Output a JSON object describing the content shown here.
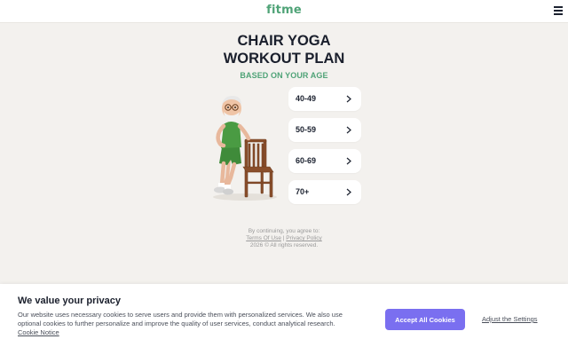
{
  "header": {
    "logo_text": "fitme",
    "brand_color": "#4fa377"
  },
  "hero": {
    "title_line1": "CHAIR YOGA",
    "title_line2": "WORKOUT PLAN",
    "subtitle": "BASED ON YOUR AGE"
  },
  "age_options": [
    {
      "label": "40-49"
    },
    {
      "label": "50-59"
    },
    {
      "label": "60-69"
    },
    {
      "label": "70+"
    }
  ],
  "legal": {
    "prefix": "By continuing, you agree to:",
    "terms_label": "Terms Of Use",
    "separator": "|",
    "privacy_label": "Privacy Policy",
    "copyright": "2026 © All rights reserved."
  },
  "cookie_banner": {
    "title": "We value your privacy",
    "text": "Our website uses necessary cookies to serve users and provide them with personalized services. We also use optional cookies to further personalize and improve the quality of user services, conduct analytical research.",
    "notice_link": "Cookie Notice",
    "accept_label": "Accept All Cookies",
    "adjust_label": "Adjust the Settings",
    "accent_color": "#7a6ff0"
  }
}
